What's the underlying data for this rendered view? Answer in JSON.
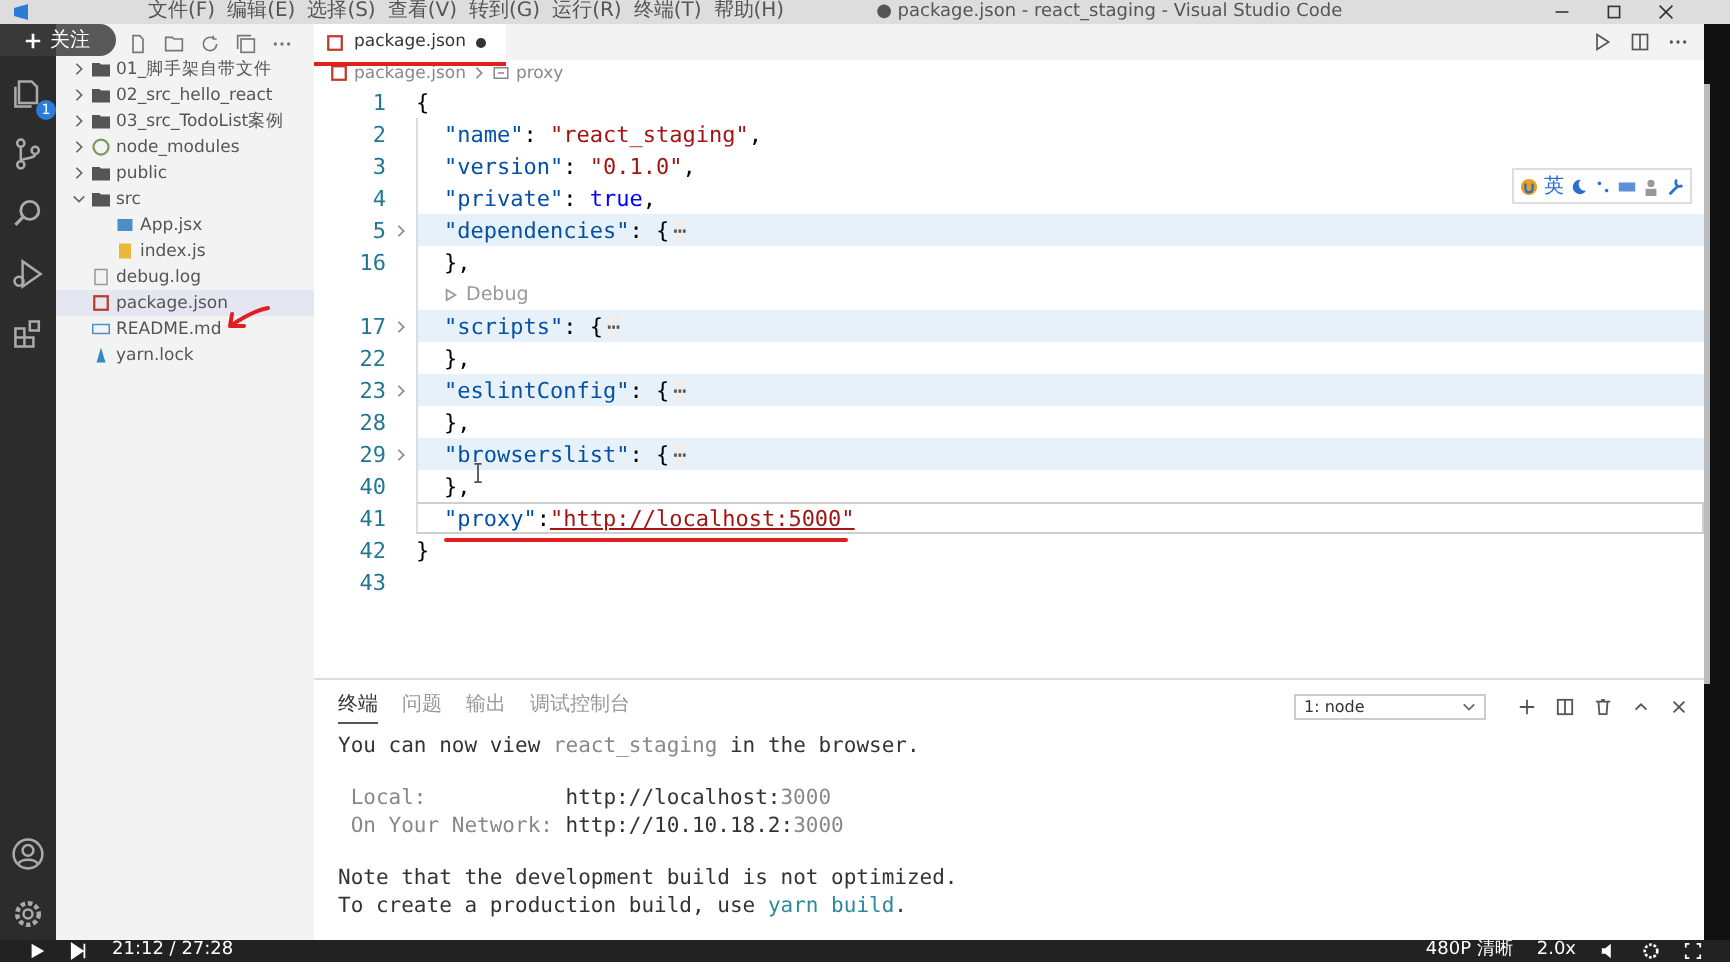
{
  "window": {
    "title": "● package.json - react_staging - Visual Studio Code",
    "menu": [
      "文件(F)",
      "编辑(E)",
      "选择(S)",
      "查看(V)",
      "转到(G)",
      "运行(R)",
      "终端(T)",
      "帮助(H)"
    ]
  },
  "follow_button": {
    "label": "关注"
  },
  "activity_bar": {
    "badge": "1"
  },
  "sidebar": {
    "items": [
      {
        "label": "01_脚手架自带文件",
        "kind": "folder",
        "expanded": false,
        "selected": false
      },
      {
        "label": "02_src_hello_react",
        "kind": "folder",
        "expanded": false,
        "selected": false
      },
      {
        "label": "03_src_TodoList案例",
        "kind": "folder",
        "expanded": false,
        "selected": false
      },
      {
        "label": "node_modules",
        "kind": "node",
        "expanded": false,
        "selected": false
      },
      {
        "label": "public",
        "kind": "folder",
        "expanded": false,
        "selected": false
      },
      {
        "label": "src",
        "kind": "folder",
        "expanded": true,
        "selected": false,
        "children": [
          {
            "label": "App.jsx",
            "kind": "jsx",
            "selected": false
          },
          {
            "label": "index.js",
            "kind": "js",
            "selected": false
          }
        ]
      },
      {
        "label": "debug.log",
        "kind": "log",
        "selected": false
      },
      {
        "label": "package.json",
        "kind": "json",
        "selected": true
      },
      {
        "label": "README.md",
        "kind": "md",
        "selected": false
      },
      {
        "label": "yarn.lock",
        "kind": "yarn",
        "selected": false
      }
    ]
  },
  "editor": {
    "tab": {
      "label": "package.json",
      "modified": true
    },
    "breadcrumbs": [
      "package.json",
      "proxy"
    ],
    "lines": [
      {
        "kind": "code",
        "number": "1",
        "indented": false,
        "folded": false,
        "current": false,
        "parts": [
          {
            "text": "{",
            "kind": "punct"
          }
        ]
      },
      {
        "kind": "code",
        "number": "2",
        "indented": true,
        "folded": false,
        "current": false,
        "parts": [
          {
            "text": "\"name\"",
            "kind": "key"
          },
          {
            "text": ": ",
            "kind": "punct"
          },
          {
            "text": "\"react_staging\"",
            "kind": "string"
          },
          {
            "text": ",",
            "kind": "punct"
          }
        ]
      },
      {
        "kind": "code",
        "number": "3",
        "indented": true,
        "folded": false,
        "current": false,
        "parts": [
          {
            "text": "\"version\"",
            "kind": "key"
          },
          {
            "text": ": ",
            "kind": "punct"
          },
          {
            "text": "\"0.1.0\"",
            "kind": "string"
          },
          {
            "text": ",",
            "kind": "punct"
          }
        ]
      },
      {
        "kind": "code",
        "number": "4",
        "indented": true,
        "folded": false,
        "current": false,
        "parts": [
          {
            "text": "\"private\"",
            "kind": "key"
          },
          {
            "text": ": ",
            "kind": "punct"
          },
          {
            "text": "true",
            "kind": "bool"
          },
          {
            "text": ",",
            "kind": "punct"
          }
        ]
      },
      {
        "kind": "code",
        "number": "5",
        "indented": true,
        "folded": true,
        "current": false,
        "parts": [
          {
            "text": "\"dependencies\"",
            "kind": "key"
          },
          {
            "text": ": {",
            "kind": "punct"
          },
          {
            "text": "⋯",
            "kind": "fold"
          }
        ]
      },
      {
        "kind": "code",
        "number": "16",
        "indented": true,
        "folded": false,
        "current": false,
        "parts": [
          {
            "text": "},",
            "kind": "punct"
          }
        ]
      },
      {
        "kind": "codelens",
        "label": "Debug"
      },
      {
        "kind": "code",
        "number": "17",
        "indented": true,
        "folded": true,
        "current": false,
        "parts": [
          {
            "text": "\"scripts\"",
            "kind": "key"
          },
          {
            "text": ": {",
            "kind": "punct"
          },
          {
            "text": "⋯",
            "kind": "fold"
          }
        ]
      },
      {
        "kind": "code",
        "number": "22",
        "indented": true,
        "folded": false,
        "current": false,
        "parts": [
          {
            "text": "},",
            "kind": "punct"
          }
        ]
      },
      {
        "kind": "code",
        "number": "23",
        "indented": true,
        "folded": true,
        "current": false,
        "parts": [
          {
            "text": "\"eslintConfig\"",
            "kind": "key"
          },
          {
            "text": ": {",
            "kind": "punct"
          },
          {
            "text": "⋯",
            "kind": "fold"
          }
        ]
      },
      {
        "kind": "code",
        "number": "28",
        "indented": true,
        "folded": false,
        "current": false,
        "parts": [
          {
            "text": "},",
            "kind": "punct"
          }
        ]
      },
      {
        "kind": "code",
        "number": "29",
        "indented": true,
        "folded": true,
        "current": false,
        "parts": [
          {
            "text": "\"browserslist\"",
            "kind": "key"
          },
          {
            "text": ": {",
            "kind": "punct"
          },
          {
            "text": "⋯",
            "kind": "fold"
          }
        ]
      },
      {
        "kind": "code",
        "number": "40",
        "indented": true,
        "folded": false,
        "current": false,
        "parts": [
          {
            "text": "},",
            "kind": "punct"
          }
        ]
      },
      {
        "kind": "code",
        "number": "41",
        "indented": true,
        "folded": false,
        "current": true,
        "parts": [
          {
            "text": "\"proxy\"",
            "kind": "key"
          },
          {
            "text": ":",
            "kind": "punct"
          },
          {
            "text": "\"http://localhost:5000\"",
            "kind": "link"
          }
        ]
      },
      {
        "kind": "code",
        "number": "42",
        "indented": false,
        "folded": false,
        "current": false,
        "parts": [
          {
            "text": "}",
            "kind": "punct"
          }
        ]
      },
      {
        "kind": "code",
        "number": "43"
      }
    ]
  },
  "ime_toolbar": {
    "label": "英"
  },
  "panel": {
    "tabs": [
      {
        "label": "终端",
        "selected": true
      },
      {
        "label": "问题",
        "selected": false
      },
      {
        "label": "输出",
        "selected": false
      },
      {
        "label": "调试控制台",
        "selected": false
      }
    ],
    "terminal_select": "1: node",
    "blocks": [
      [
        [
          {
            "text": "You can now view ",
            "kind": "plain"
          },
          {
            "text": "react_staging",
            "kind": "muted"
          },
          {
            "text": " in the browser.",
            "kind": "plain"
          }
        ]
      ],
      [
        [
          {
            "text": "Local:",
            "kind": "label"
          },
          {
            "text": "http://localhost:",
            "kind": "plain"
          },
          {
            "text": "3000",
            "kind": "muted"
          }
        ],
        [
          {
            "text": "On Your Network:",
            "kind": "label"
          },
          {
            "text": "http://10.10.18.2:",
            "kind": "plain"
          },
          {
            "text": "3000",
            "kind": "muted"
          }
        ]
      ],
      [
        [
          {
            "text": "Note that the development build is not optimized.",
            "kind": "plain"
          }
        ],
        [
          {
            "text": "To create a production build, use ",
            "kind": "plain"
          },
          {
            "text": "yarn build",
            "kind": "link"
          },
          {
            "text": ".",
            "kind": "plain"
          }
        ]
      ]
    ]
  },
  "player": {
    "time": "21:12 / 27:28",
    "quality": "480P 清晰",
    "speed": "2.0x"
  }
}
